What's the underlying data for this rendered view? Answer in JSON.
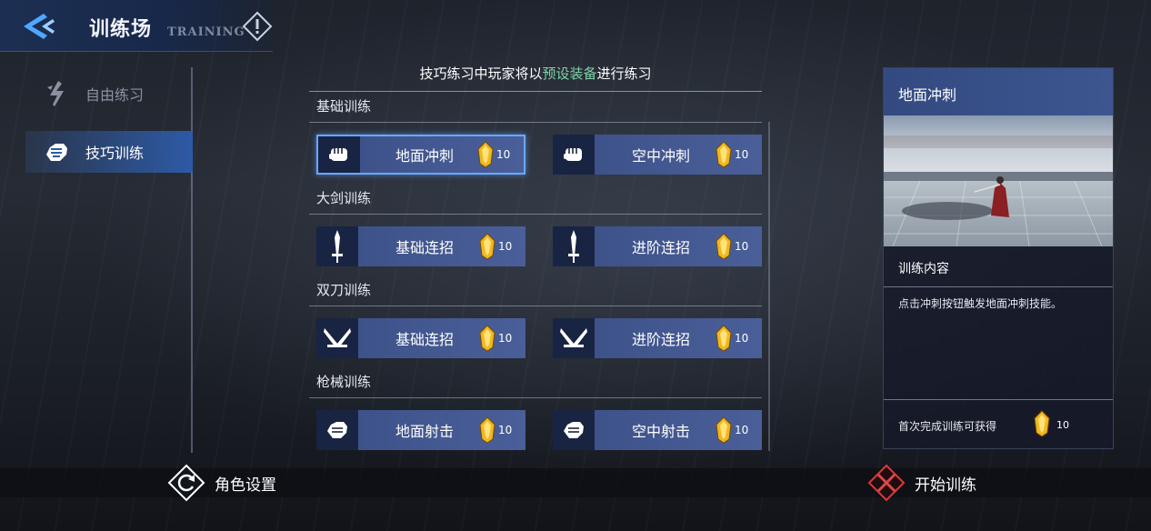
{
  "header": {
    "title": "训练场",
    "subtitle": "TRAINING"
  },
  "nav": {
    "items": [
      {
        "label": "自由练习",
        "icon": "free-practice-icon",
        "selected": false
      },
      {
        "label": "技巧训练",
        "icon": "skill-training-icon",
        "selected": true
      }
    ]
  },
  "notice": {
    "prefix": "技巧练习中玩家将以",
    "highlight": "预设装备",
    "suffix": "进行练习",
    "highlight_color": "#7fd3a8"
  },
  "categories": [
    {
      "title": "基础训练",
      "cards": [
        {
          "label": "地面冲刺",
          "reward": "10",
          "icon": "fist-icon",
          "selected": true
        },
        {
          "label": "空中冲刺",
          "reward": "10",
          "icon": "fist-icon",
          "selected": false
        }
      ]
    },
    {
      "title": "大剑训练",
      "cards": [
        {
          "label": "基础连招",
          "reward": "10",
          "icon": "sword-icon",
          "selected": false
        },
        {
          "label": "进阶连招",
          "reward": "10",
          "icon": "sword-icon",
          "selected": false
        }
      ]
    },
    {
      "title": "双刀训练",
      "cards": [
        {
          "label": "基础连招",
          "reward": "10",
          "icon": "dual-blades-icon",
          "selected": false
        },
        {
          "label": "进阶连招",
          "reward": "10",
          "icon": "dual-blades-icon",
          "selected": false
        }
      ]
    },
    {
      "title": "枪械训练",
      "cards": [
        {
          "label": "地面射击",
          "reward": "10",
          "icon": "gun-hand-icon",
          "selected": false
        },
        {
          "label": "空中射击",
          "reward": "10",
          "icon": "gun-hand-icon",
          "selected": false
        }
      ]
    }
  ],
  "detail": {
    "title": "地面冲刺",
    "content_label": "训练内容",
    "content_text": "点击冲刺按钮触发地面冲刺技能。",
    "reward_label": "首次完成训练可获得",
    "reward_value": "10"
  },
  "bottom": {
    "role_settings": "角色设置",
    "start_training": "开始训练"
  },
  "colors": {
    "accent": "#2d5aa6",
    "card": "#44588f",
    "selected_border": "#6aa8ff",
    "gem": "#f0b820"
  }
}
